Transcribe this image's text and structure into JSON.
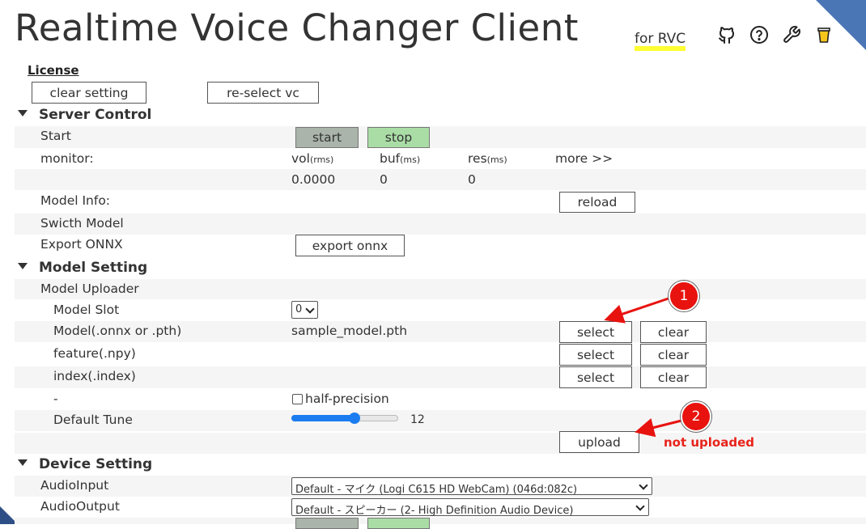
{
  "header": {
    "title": "Realtime Voice Changer Client",
    "subtitle": "for RVC",
    "icons": [
      "github-icon",
      "help-icon",
      "wrench-icon",
      "coffee-icon"
    ]
  },
  "license_link": "License",
  "top_buttons": {
    "clear_setting": "clear setting",
    "reselect_vc": "re-select vc"
  },
  "server_control": {
    "title": "Server Control",
    "start_label": "Start",
    "start_button": "start",
    "stop_button": "stop",
    "monitor_label": "monitor:",
    "vol_label": "vol",
    "vol_unit": "(rms)",
    "buf_label": "buf",
    "buf_unit": "(ms)",
    "res_label": "res",
    "res_unit": "(ms)",
    "more_link": "more >>",
    "vol_value": "0.0000",
    "buf_value": "0",
    "res_value": "0",
    "model_info_label": "Model Info:",
    "reload_button": "reload",
    "switch_model_label": "Swicth Model",
    "export_onnx_label": "Export ONNX",
    "export_onnx_button": "export onnx"
  },
  "model_setting": {
    "title": "Model Setting",
    "uploader_label": "Model Uploader",
    "slot_label": "Model Slot",
    "slot_value": "0",
    "model_label": "Model(.onnx or .pth)",
    "model_file": "sample_model.pth",
    "feature_label": "feature(.npy)",
    "index_label": "index(.index)",
    "select_button": "select",
    "clear_button": "clear",
    "dash_label": "-",
    "half_precision_label": "half-precision",
    "half_precision_checked": false,
    "default_tune_label": "Default Tune",
    "default_tune_value": "12",
    "default_tune_fraction": 0.6,
    "upload_button": "upload"
  },
  "device_setting": {
    "title": "Device Setting",
    "audio_input_label": "AudioInput",
    "audio_input_value": "Default - マイク (Logi C615 HD WebCam) (046d:082c)",
    "audio_output_label": "AudioOutput",
    "audio_output_value": "Default - スピーカー (2- High Definition Audio Device)"
  },
  "annotations": {
    "badge1": "1",
    "badge2": "2",
    "not_uploaded": "not uploaded",
    "arrow_color": "#e8130f"
  },
  "colors": {
    "start_button": "#aab4aa",
    "stop_button": "#aadda6",
    "highlight": "#ffff33",
    "slider": "#1a7cf0",
    "corner": "#4b76b6"
  }
}
